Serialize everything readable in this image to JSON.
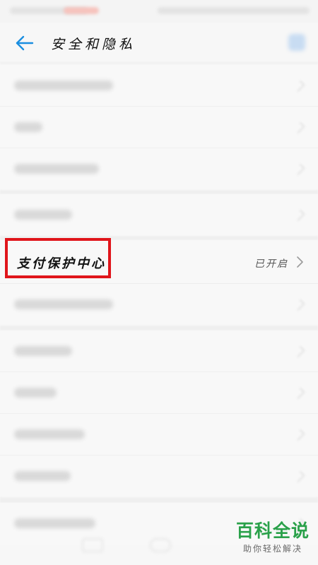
{
  "header": {
    "title": "安全和隐私"
  },
  "list": {
    "pay_protection": {
      "label": "支付保护中心",
      "status": "已开启"
    }
  },
  "watermark": {
    "main": "百科全说",
    "sub": "助你轻松解决"
  },
  "colors": {
    "accent_blue": "#1a8ee0",
    "highlight_red": "#e0151b",
    "watermark_green": "#2aa14a"
  },
  "icons": {
    "back": "arrow-left-icon",
    "chevron": "chevron-right-icon",
    "search": "search-icon"
  }
}
